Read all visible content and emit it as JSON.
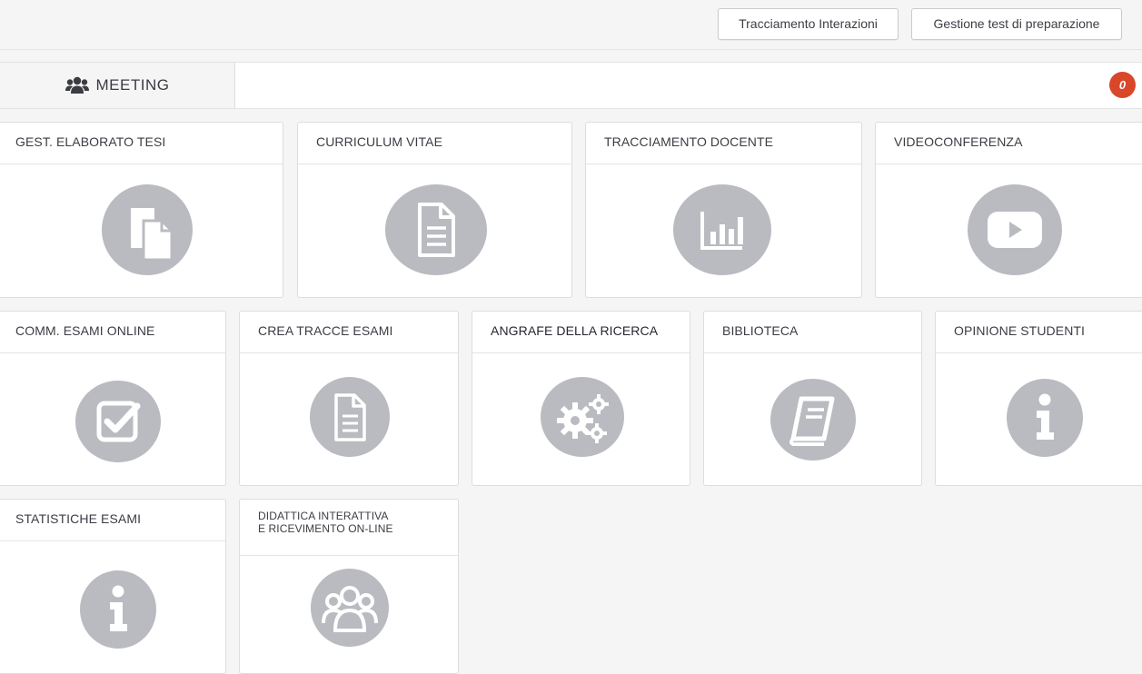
{
  "top_buttons": {
    "tracking": "Tracciamento Interazioni",
    "prep_tests": "Gestione test di preparazione"
  },
  "meeting_bar": {
    "tab_label": "MEETING",
    "tab_icon": "users-icon",
    "badge_count": "0",
    "badge_color": "#d9472b"
  },
  "tiles": [
    {
      "label": "GEST. ELABORATO TESI",
      "icon": "documents-icon"
    },
    {
      "label": "CURRICULUM VITAE",
      "icon": "file-text-icon"
    },
    {
      "label": "TRACCIAMENTO DOCENTE",
      "icon": "bar-chart-icon"
    },
    {
      "label": "VIDEOCONFERENZA",
      "icon": "play-icon"
    },
    {
      "label": "COMM. ESAMI ONLINE",
      "icon": "checkbox-icon"
    },
    {
      "label": "CREA TRACCE ESAMI",
      "icon": "file-text-icon"
    },
    {
      "label": "ANGRAFE DELLA RICERCA",
      "icon": "gears-icon"
    },
    {
      "label": "BIBLIOTECA",
      "icon": "book-icon"
    },
    {
      "label": "OPINIONE STUDENTI",
      "icon": "info-icon"
    },
    {
      "label": "STATISTICHE ESAMI",
      "icon": "info-icon"
    },
    {
      "label_line1": "DIDATTICA INTERATTIVA",
      "label_line2": "E RICEVIMENTO ON-LINE",
      "icon": "users-icon"
    }
  ],
  "colors": {
    "page_bg": "#f5f5f6",
    "icon_circle": "#b9bbc0",
    "icon_glyph": "#ffffff"
  }
}
